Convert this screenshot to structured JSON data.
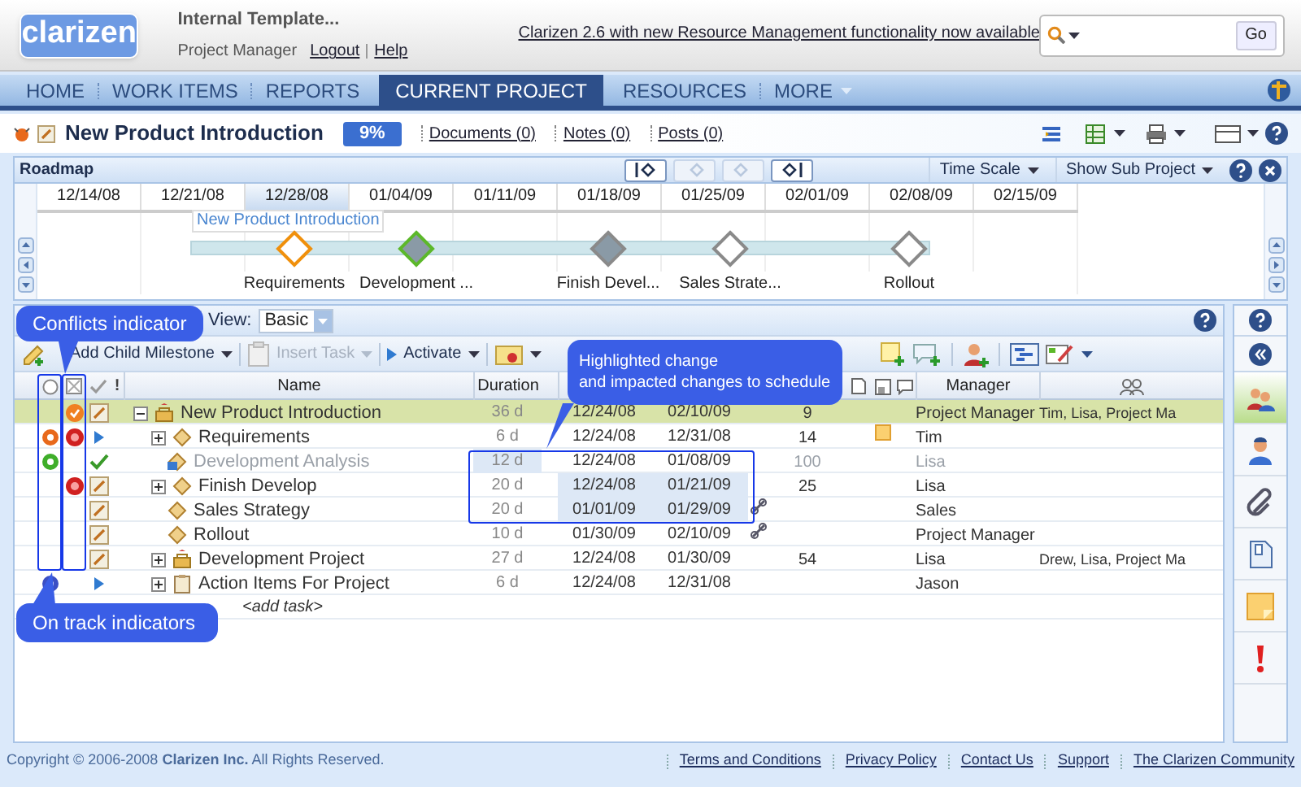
{
  "header": {
    "logo": "clarizen",
    "project_name": "Internal Template...",
    "role": "Project Manager",
    "links": [
      {
        "label": "Logout"
      },
      {
        "label": "Help"
      }
    ],
    "announcement": "Clarizen 2.6 with new Resource Management functionality now available",
    "search": {
      "button": "Go"
    }
  },
  "nav": {
    "tabs": [
      {
        "label": "HOME",
        "selected": false
      },
      {
        "label": "WORK ITEMS",
        "selected": false
      },
      {
        "label": "REPORTS",
        "selected": false
      },
      {
        "label": "CURRENT PROJECT",
        "selected": true
      },
      {
        "label": "RESOURCES",
        "selected": false
      },
      {
        "label": "MORE",
        "selected": false
      }
    ]
  },
  "project": {
    "title": "New Product Introduction",
    "progress": "9%",
    "links": [
      {
        "label": "Documents (0)"
      },
      {
        "label": "Notes (0)"
      },
      {
        "label": "Posts (0)"
      }
    ]
  },
  "roadmap": {
    "title": "Roadmap",
    "controls": [
      {
        "label": "Time Scale"
      },
      {
        "label": "Show Sub Project"
      }
    ],
    "dates": [
      {
        "label": "12/14/08",
        "selected": false
      },
      {
        "label": "12/21/08",
        "selected": false
      },
      {
        "label": "12/28/08",
        "selected": true
      },
      {
        "label": "01/04/09",
        "selected": false
      },
      {
        "label": "01/11/09",
        "selected": false
      },
      {
        "label": "01/18/09",
        "selected": false
      },
      {
        "label": "01/25/09",
        "selected": false
      },
      {
        "label": "02/01/09",
        "selected": false
      },
      {
        "label": "02/08/09",
        "selected": false
      },
      {
        "label": "02/15/09",
        "selected": false
      }
    ],
    "bar_label": "New Product Introduction",
    "milestones": [
      {
        "label": "Requirements",
        "color": "#f0900c",
        "filled": false
      },
      {
        "label": "Development ...",
        "color": "#5cb82a",
        "filled": true
      },
      {
        "label": "Finish Devel...",
        "color": "#8a8a8a",
        "filled": true
      },
      {
        "label": "Sales Strate...",
        "color": "#8a8a8a",
        "filled": false
      },
      {
        "label": "Rollout",
        "color": "#8a8a8a",
        "filled": false
      }
    ]
  },
  "work_plan": {
    "view_label": "View:",
    "view": "Basic",
    "toolbar": [
      {
        "label": "Add Child Milestone",
        "disabled": false
      },
      {
        "label": "Insert Task",
        "disabled": true
      },
      {
        "label": "Activate",
        "disabled": false
      }
    ],
    "columns": [
      {
        "label": "!"
      },
      {
        "label": "Name"
      },
      {
        "label": "Duration"
      },
      {
        "label": "Manager"
      }
    ],
    "rows": [
      {
        "name": "New Product Introduction",
        "kind": "project",
        "expandable": true,
        "expanded": true,
        "selected": true,
        "completed": false,
        "active": false,
        "warning": true,
        "conflict": false,
        "duration": "36 d",
        "start": "12/24/08",
        "due": "02/10/09",
        "changed": [
          false,
          false,
          false
        ],
        "linked": false,
        "work": "9",
        "note": false,
        "manager": "Project Manager",
        "resources": "Tim, Lisa, Project Ma",
        "children": [
          {
            "name": "Requirements",
            "kind": "milestone",
            "expandable": true,
            "expanded": false,
            "selected": false,
            "completed": false,
            "active": true,
            "color": "#e8691c",
            "warning": false,
            "conflict": true,
            "duration": "6 d",
            "start": "12/24/08",
            "due": "12/31/08",
            "changed": [
              false,
              false,
              false
            ],
            "linked": false,
            "work": "14",
            "note": true,
            "manager": "Tim"
          },
          {
            "name": "Development Analysis",
            "kind": "task",
            "expandable": false,
            "selected": false,
            "completed": true,
            "color": "#3fae2a",
            "warning": false,
            "conflict": false,
            "duration": "12 d",
            "start": "12/24/08",
            "due": "01/08/09",
            "changed": [
              true,
              false,
              false
            ],
            "linked": false,
            "work": "100",
            "note": false,
            "manager": "Lisa"
          },
          {
            "name": "Finish Develop",
            "kind": "milestone",
            "expandable": true,
            "expanded": false,
            "selected": false,
            "completed": false,
            "active": false,
            "warning": false,
            "conflict": true,
            "duration": "20 d",
            "start": "12/24/08",
            "due": "01/21/09",
            "changed": [
              false,
              true,
              true
            ],
            "linked": false,
            "work": "25",
            "note": false,
            "manager": "Lisa"
          },
          {
            "name": "Sales Strategy",
            "kind": "milestone",
            "expandable": false,
            "selected": false,
            "completed": false,
            "active": false,
            "warning": false,
            "conflict": false,
            "duration": "20 d",
            "start": "01/01/09",
            "due": "01/29/09",
            "changed": [
              false,
              true,
              true
            ],
            "linked": true,
            "note": false,
            "manager": "Sales"
          },
          {
            "name": "Rollout",
            "kind": "milestone",
            "expandable": false,
            "selected": false,
            "completed": false,
            "active": false,
            "warning": false,
            "conflict": false,
            "duration": "10 d",
            "start": "01/30/09",
            "due": "02/10/09",
            "changed": [
              false,
              false,
              false
            ],
            "linked": true,
            "note": false,
            "manager": "Project Manager"
          },
          {
            "name": "Development Project",
            "kind": "project",
            "expandable": true,
            "expanded": false,
            "selected": false,
            "completed": false,
            "active": false,
            "warning": false,
            "conflict": false,
            "duration": "27 d",
            "start": "12/24/08",
            "due": "01/30/09",
            "changed": [
              false,
              false,
              false
            ],
            "linked": false,
            "work": "54",
            "note": false,
            "manager": "Lisa",
            "resources": "Drew, Lisa, Project Ma"
          },
          {
            "name": "Action Items For Project",
            "kind": "action-items",
            "expandable": true,
            "expanded": false,
            "selected": false,
            "completed": false,
            "active": true,
            "color": "#3b4fc4",
            "warning": false,
            "conflict": false,
            "duration": "6 d",
            "start": "12/24/08",
            "due": "12/31/08",
            "changed": [
              false,
              false,
              false
            ],
            "linked": false,
            "note": false,
            "manager": "Jason"
          }
        ]
      }
    ],
    "add_task": "<add task>"
  },
  "sidebar": [
    {
      "kind": "team",
      "selected": true
    },
    {
      "kind": "user",
      "selected": false
    },
    {
      "kind": "clip",
      "selected": false
    },
    {
      "kind": "document",
      "selected": false
    },
    {
      "kind": "note",
      "selected": false
    },
    {
      "kind": "alert",
      "selected": false
    }
  ],
  "callouts": [
    {
      "text": "Conflicts indicator"
    },
    {
      "text": "Highlighted change\nand impacted changes to schedule"
    },
    {
      "text": "On track indicators"
    }
  ],
  "footer": {
    "copyright": "Copyright © 2006-2008 **Clarizen Inc.** All Rights Reserved.",
    "links": [
      {
        "label": "Terms and Conditions"
      },
      {
        "label": "Privacy Policy"
      },
      {
        "label": "Contact Us"
      },
      {
        "label": "Support"
      },
      {
        "label": "The Clarizen Community"
      }
    ]
  }
}
